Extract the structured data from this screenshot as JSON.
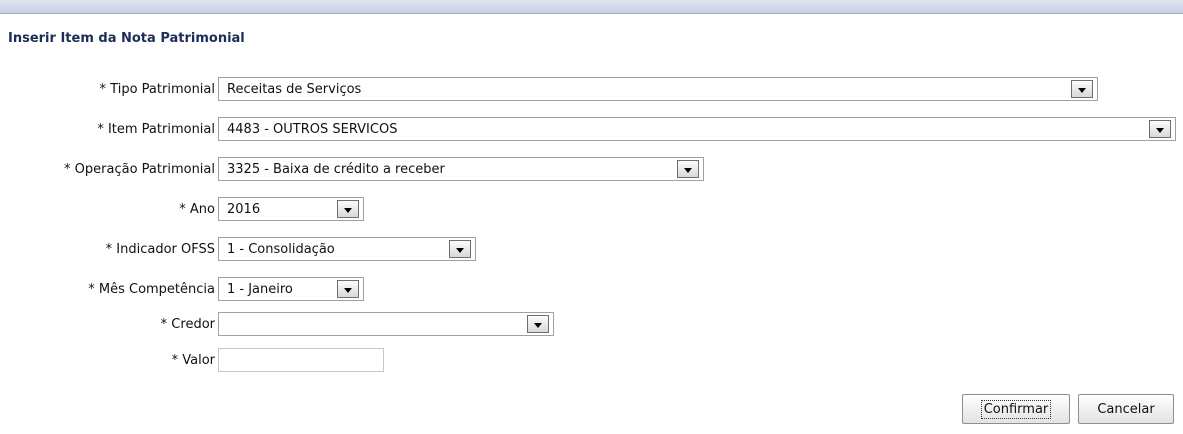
{
  "dialog": {
    "title": "Inserir Item da Nota Patrimonial"
  },
  "form": {
    "tipo_patrimonial": {
      "label": "* Tipo Patrimonial",
      "value": "Receitas de Serviços"
    },
    "item_patrimonial": {
      "label": "* Item Patrimonial",
      "value": "4483 - OUTROS SERVICOS"
    },
    "operacao_patrimonial": {
      "label": "* Operação Patrimonial",
      "value": "3325 - Baixa de crédito a receber"
    },
    "ano": {
      "label": "* Ano",
      "value": "2016"
    },
    "indicador_ofss": {
      "label": "* Indicador OFSS",
      "value": "1 - Consolidação"
    },
    "mes_competencia": {
      "label": "* Mês Competência",
      "value": "1 - Janeiro"
    },
    "credor": {
      "label": "* Credor",
      "value": ""
    },
    "valor": {
      "label": "* Valor",
      "value": ""
    }
  },
  "actions": {
    "confirm_label": "Confirmar",
    "cancel_label": "Cancelar"
  },
  "icons": {
    "dropdown": "chevron-down-icon"
  }
}
